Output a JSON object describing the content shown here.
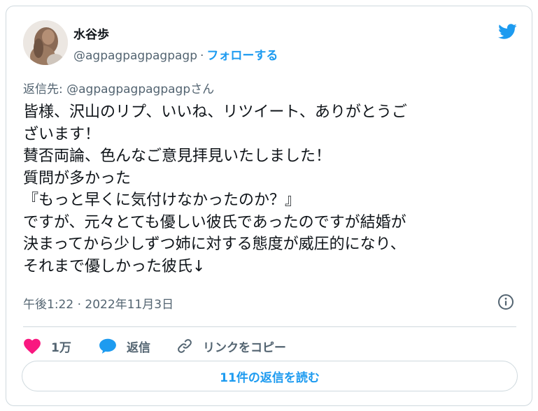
{
  "colors": {
    "accent": "#1d9bf0",
    "secondary_text": "#536471",
    "primary_text": "#0f1419",
    "heart": "#f91880",
    "border": "#cfd9de"
  },
  "author": {
    "name": "水谷歩",
    "handle": "@agpagpagpagpagp",
    "separator": "·",
    "follow_label": "フォローする"
  },
  "reply_to": "返信先: @agpagpagpagpagpさん",
  "tweet": {
    "text": "皆様、沢山のリプ、いいね、リツイート、ありがとうご\nざいます！\n賛否両論、色んなご意見拝見いたしました！\n質問が多かった\n『もっと早くに気付けなかったのか？』\nですが、元々とても優しい彼氏であったのですが結婚が\n決まってから少しずつ姉に対する態度が威圧的になり、\nそれまで優しかった彼氏↓",
    "timestamp": "午後1:22 · 2022年11月3日"
  },
  "actions": {
    "like_count": "1万",
    "reply_label": "返信",
    "copy_link_label": "リンクをコピー"
  },
  "read_replies_label": "11件の返信を読む",
  "icons": {
    "brand": "twitter-bird-icon",
    "info": "info-icon",
    "like": "heart-icon",
    "reply": "speech-bubble-icon",
    "copy_link": "link-icon"
  }
}
